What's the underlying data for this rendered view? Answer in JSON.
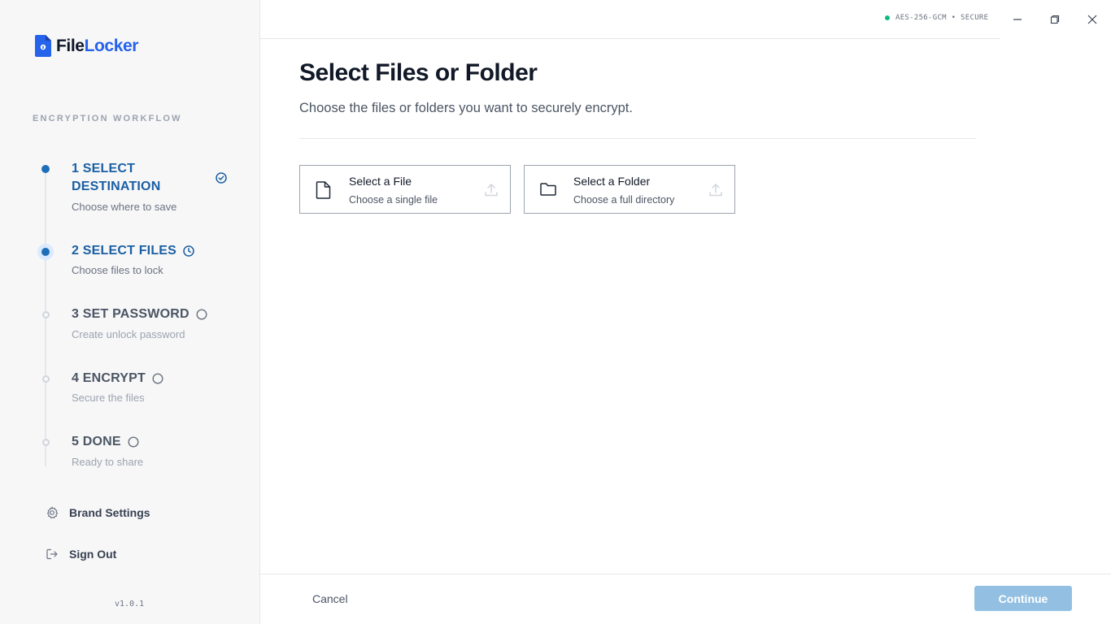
{
  "app": {
    "logo_part1": "File",
    "logo_part2": "Locker",
    "status": "AES-256-GCM • SECURE",
    "version": "v1.0.1"
  },
  "sidebar": {
    "section_label": "ENCRYPTION WORKFLOW",
    "steps": [
      {
        "title_line1": "1 SELECT",
        "title_line2": "DESTINATION",
        "subtitle": "Choose where to save",
        "state": "completed"
      },
      {
        "title": "2 SELECT FILES",
        "subtitle": "Choose files to lock",
        "state": "in-progress"
      },
      {
        "title": "3 SET PASSWORD",
        "subtitle": "Create unlock password",
        "state": "pending"
      },
      {
        "title": "4 ENCRYPT",
        "subtitle": "Secure the files",
        "state": "pending"
      },
      {
        "title": "5 DONE",
        "subtitle": "Ready to share",
        "state": "pending"
      }
    ],
    "links": [
      {
        "label": "Brand Settings",
        "icon": "gear-icon"
      },
      {
        "label": "Sign Out",
        "icon": "sign-out-icon"
      }
    ]
  },
  "main": {
    "title": "Select Files or Folder",
    "description": "Choose the files or folders you want to securely encrypt.",
    "options": [
      {
        "title": "Select a File",
        "subtitle": "Choose a single file",
        "icon": "file-icon"
      },
      {
        "title": "Select a Folder",
        "subtitle": "Choose a full directory",
        "icon": "folder-icon"
      }
    ]
  },
  "footer": {
    "cancel_label": "Cancel",
    "continue_label": "Continue"
  },
  "colors": {
    "accent": "#1a5fa3",
    "brand": "#2563eb",
    "continue_disabled": "#93c0e2",
    "secure_dot": "#10b981"
  }
}
